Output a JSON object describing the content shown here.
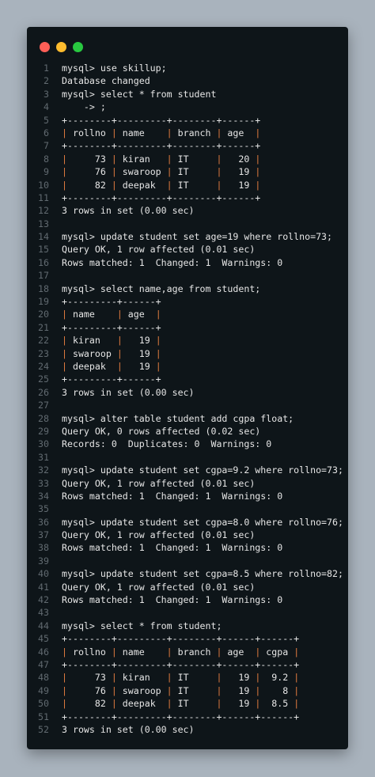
{
  "window": {
    "controls": [
      "close",
      "minimize",
      "maximize"
    ],
    "colors": {
      "close": "#ff5f57",
      "minimize": "#febc2e",
      "maximize": "#28c840",
      "background": "#0e1519",
      "text": "#e6e6e6",
      "line_number": "#616a70",
      "table_pipe": "#e07b3f"
    }
  },
  "lines": [
    {
      "n": "1",
      "text": "mysql> use skillup;"
    },
    {
      "n": "2",
      "text": "Database changed"
    },
    {
      "n": "3",
      "text": "mysql> select * from student"
    },
    {
      "n": "4",
      "text": "    -> ;"
    },
    {
      "n": "5",
      "text": "+--------+---------+--------+------+"
    },
    {
      "n": "6",
      "text": "| rollno | name    | branch | age  |"
    },
    {
      "n": "7",
      "text": "+--------+---------+--------+------+"
    },
    {
      "n": "8",
      "text": "|     73 | kiran   | IT     |   20 |"
    },
    {
      "n": "9",
      "text": "|     76 | swaroop | IT     |   19 |"
    },
    {
      "n": "10",
      "text": "|     82 | deepak  | IT     |   19 |"
    },
    {
      "n": "11",
      "text": "+--------+---------+--------+------+"
    },
    {
      "n": "12",
      "text": "3 rows in set (0.00 sec)"
    },
    {
      "n": "13",
      "text": ""
    },
    {
      "n": "14",
      "text": "mysql> update student set age=19 where rollno=73;"
    },
    {
      "n": "15",
      "text": "Query OK, 1 row affected (0.01 sec)"
    },
    {
      "n": "16",
      "text": "Rows matched: 1  Changed: 1  Warnings: 0"
    },
    {
      "n": "17",
      "text": ""
    },
    {
      "n": "18",
      "text": "mysql> select name,age from student;"
    },
    {
      "n": "19",
      "text": "+---------+------+"
    },
    {
      "n": "20",
      "text": "| name    | age  |"
    },
    {
      "n": "21",
      "text": "+---------+------+"
    },
    {
      "n": "22",
      "text": "| kiran   |   19 |"
    },
    {
      "n": "23",
      "text": "| swaroop |   19 |"
    },
    {
      "n": "24",
      "text": "| deepak  |   19 |"
    },
    {
      "n": "25",
      "text": "+---------+------+"
    },
    {
      "n": "26",
      "text": "3 rows in set (0.00 sec)"
    },
    {
      "n": "27",
      "text": ""
    },
    {
      "n": "28",
      "text": "mysql> alter table student add cgpa float;"
    },
    {
      "n": "29",
      "text": "Query OK, 0 rows affected (0.02 sec)"
    },
    {
      "n": "30",
      "text": "Records: 0  Duplicates: 0  Warnings: 0"
    },
    {
      "n": "31",
      "text": ""
    },
    {
      "n": "32",
      "text": "mysql> update student set cgpa=9.2 where rollno=73;"
    },
    {
      "n": "33",
      "text": "Query OK, 1 row affected (0.01 sec)"
    },
    {
      "n": "34",
      "text": "Rows matched: 1  Changed: 1  Warnings: 0"
    },
    {
      "n": "35",
      "text": ""
    },
    {
      "n": "36",
      "text": "mysql> update student set cgpa=8.0 where rollno=76;"
    },
    {
      "n": "37",
      "text": "Query OK, 1 row affected (0.01 sec)"
    },
    {
      "n": "38",
      "text": "Rows matched: 1  Changed: 1  Warnings: 0"
    },
    {
      "n": "39",
      "text": ""
    },
    {
      "n": "40",
      "text": "mysql> update student set cgpa=8.5 where rollno=82;"
    },
    {
      "n": "41",
      "text": "Query OK, 1 row affected (0.01 sec)"
    },
    {
      "n": "42",
      "text": "Rows matched: 1  Changed: 1  Warnings: 0"
    },
    {
      "n": "43",
      "text": ""
    },
    {
      "n": "44",
      "text": "mysql> select * from student;"
    },
    {
      "n": "45",
      "text": "+--------+---------+--------+------+------+"
    },
    {
      "n": "46",
      "text": "| rollno | name    | branch | age  | cgpa |"
    },
    {
      "n": "47",
      "text": "+--------+---------+--------+------+------+"
    },
    {
      "n": "48",
      "text": "|     73 | kiran   | IT     |   19 |  9.2 |"
    },
    {
      "n": "49",
      "text": "|     76 | swaroop | IT     |   19 |    8 |"
    },
    {
      "n": "50",
      "text": "|     82 | deepak  | IT     |   19 |  8.5 |"
    },
    {
      "n": "51",
      "text": "+--------+---------+--------+------+------+"
    },
    {
      "n": "52",
      "text": "3 rows in set (0.00 sec)"
    }
  ]
}
